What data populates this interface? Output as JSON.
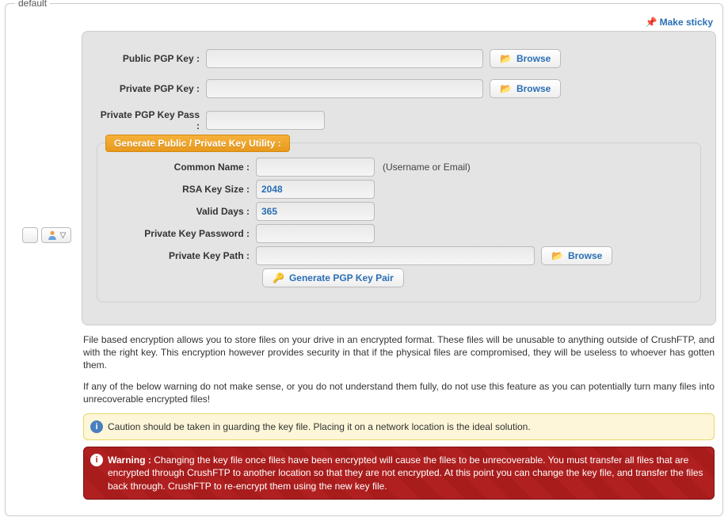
{
  "legend": "default",
  "sticky": {
    "label": "Make sticky"
  },
  "form": {
    "public_pgp_key_label": "Public PGP Key :",
    "private_pgp_key_label": "Private PGP Key :",
    "private_pgp_key_pass_label": "Private PGP Key Pass :",
    "public_pgp_key": "",
    "private_pgp_key": "",
    "private_pgp_key_pass": "",
    "browse_label": "Browse"
  },
  "keygen": {
    "legend": "Generate Public / Private Key Utility :",
    "common_name_label": "Common Name :",
    "common_name": "",
    "common_name_hint": "(Username or Email)",
    "rsa_key_size_label": "RSA Key Size :",
    "rsa_key_size": "2048",
    "valid_days_label": "Valid Days :",
    "valid_days": "365",
    "private_key_password_label": "Private Key Password :",
    "private_key_password": "",
    "private_key_path_label": "Private Key Path :",
    "private_key_path": "",
    "browse_label": "Browse",
    "generate_label": "Generate PGP Key Pair"
  },
  "desc1": "File based encryption allows you to store files on your drive in an encrypted format. These files will be unusable to anything outside of CrushFTP, and with the right key. This encryption however provides security in that if the physical files are compromised, they will be useless to whoever has gotten them.",
  "desc2": "If any of the below warning do not make sense, or you do not understand them fully, do not use this feature as you can potentially turn many files into unrecoverable encrypted files!",
  "caution": "Caution should be taken in guarding the key file. Placing it on a network location is the ideal solution.",
  "warning_label": "Warning :",
  "warning": "Changing the key file once files have been encrypted will cause the files to be unrecoverable. You must transfer all files that are encrypted through CrushFTP to another location so that they are not encrypted. At this point you can change the key file, and transfer the files back through. CrushFTP to re-encrypt them using the new key file."
}
